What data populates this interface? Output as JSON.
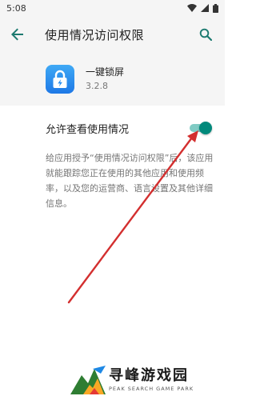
{
  "status_bar": {
    "time": "5:08"
  },
  "app_bar": {
    "title": "使用情况访问权限",
    "back_icon": "arrow-back-icon",
    "search_icon": "search-icon"
  },
  "app": {
    "name": "一键锁屏",
    "version": "3.2.8",
    "icon": "lock-app-icon"
  },
  "preference": {
    "label": "允许查看使用情况",
    "enabled": true
  },
  "description": "给应用授予“使用情况访问权限”后，该应用就能跟踪您正在使用的其他应用和使用频率，以及您的运营商、语言设置及其他详细信息。",
  "watermark": {
    "title": "寻峰游戏园",
    "subtitle": "PEAK SEARCH GAME PARK"
  },
  "colors": {
    "accent": "#00897b",
    "toggle_track": "#80cbc4",
    "annotation_arrow": "#d32f2f"
  }
}
